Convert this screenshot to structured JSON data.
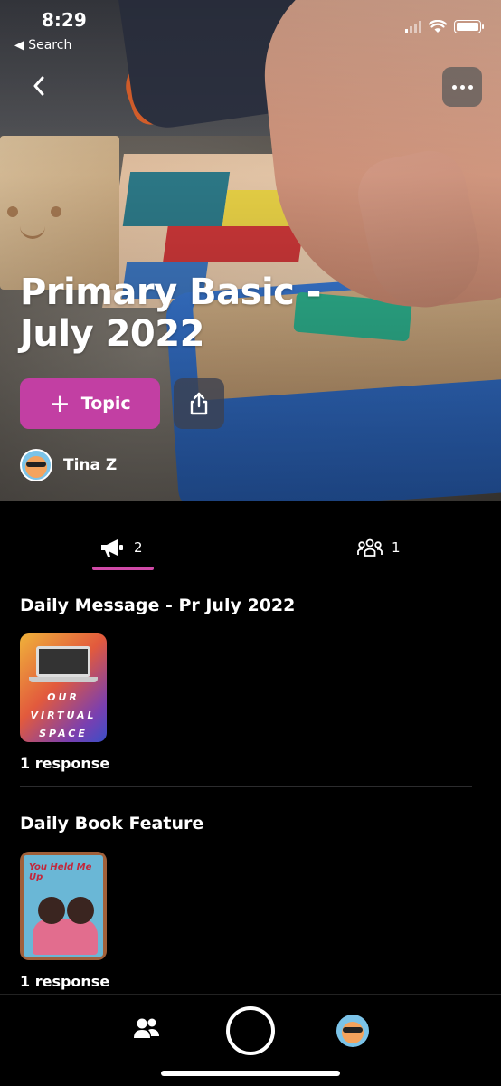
{
  "status_bar": {
    "time": "8:29",
    "back_app": "◀ Search"
  },
  "header": {
    "title": "Primary Basic - July 2022",
    "topic_button_label": "Topic",
    "owner_name": "Tina Z",
    "back_icon": "chevron-left-icon",
    "more_icon": "more-horizontal-icon",
    "share_icon": "share-icon"
  },
  "tabs": {
    "posts_count": "2",
    "members_count": "1"
  },
  "posts": [
    {
      "title": "Daily Message - Pr July 2022",
      "thumb_text": [
        "OUR",
        "VIRTUAL",
        "SPACE"
      ],
      "responses": "1 response"
    },
    {
      "title": "Daily Book Feature",
      "thumb_text": "You Held Me Up",
      "responses": "1 response"
    }
  ],
  "colors": {
    "accent": "#c23fa3",
    "tab_underline": "#d14aa8",
    "background": "#000000"
  }
}
